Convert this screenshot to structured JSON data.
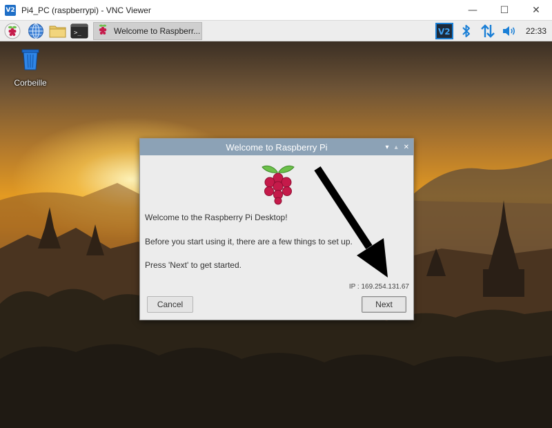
{
  "vnc_window": {
    "logo_text": "V2",
    "title": "Pi4_PC (raspberrypi) - VNC Viewer",
    "controls": {
      "minimize": "—",
      "maximize": "☐",
      "close": "✕"
    }
  },
  "taskbar": {
    "icons": [
      "raspberry-menu-icon",
      "web-browser-icon",
      "file-manager-icon",
      "terminal-icon"
    ],
    "terminal_glyph": ">_",
    "window_button_label": "Welcome to Raspberr...",
    "tray": [
      "vnc-icon",
      "bluetooth-icon",
      "network-icon",
      "volume-icon"
    ],
    "vnc_tray_text": "V2",
    "clock": "22:33"
  },
  "desktop": {
    "trash_label": "Corbeille"
  },
  "dialog": {
    "title": "Welcome to Raspberry Pi",
    "controls": {
      "minimize": "▾",
      "maximize": "▴",
      "close": "✕"
    },
    "welcome_text": "Welcome to the Raspberry Pi Desktop!",
    "setup_text": "Before you start using it, there are a few things to set up.",
    "start_text": "Press 'Next' to get started.",
    "ip_text": "IP : 169.254.131.67",
    "cancel_label": "Cancel",
    "next_label": "Next"
  },
  "colors": {
    "dialog_titlebar": "#8ca2b6",
    "raspberry_red": "#c51a4a",
    "leaf_green": "#6cc04a",
    "vnc_blue": "#1f6fc7",
    "tray_blue": "#1a7fd6"
  }
}
